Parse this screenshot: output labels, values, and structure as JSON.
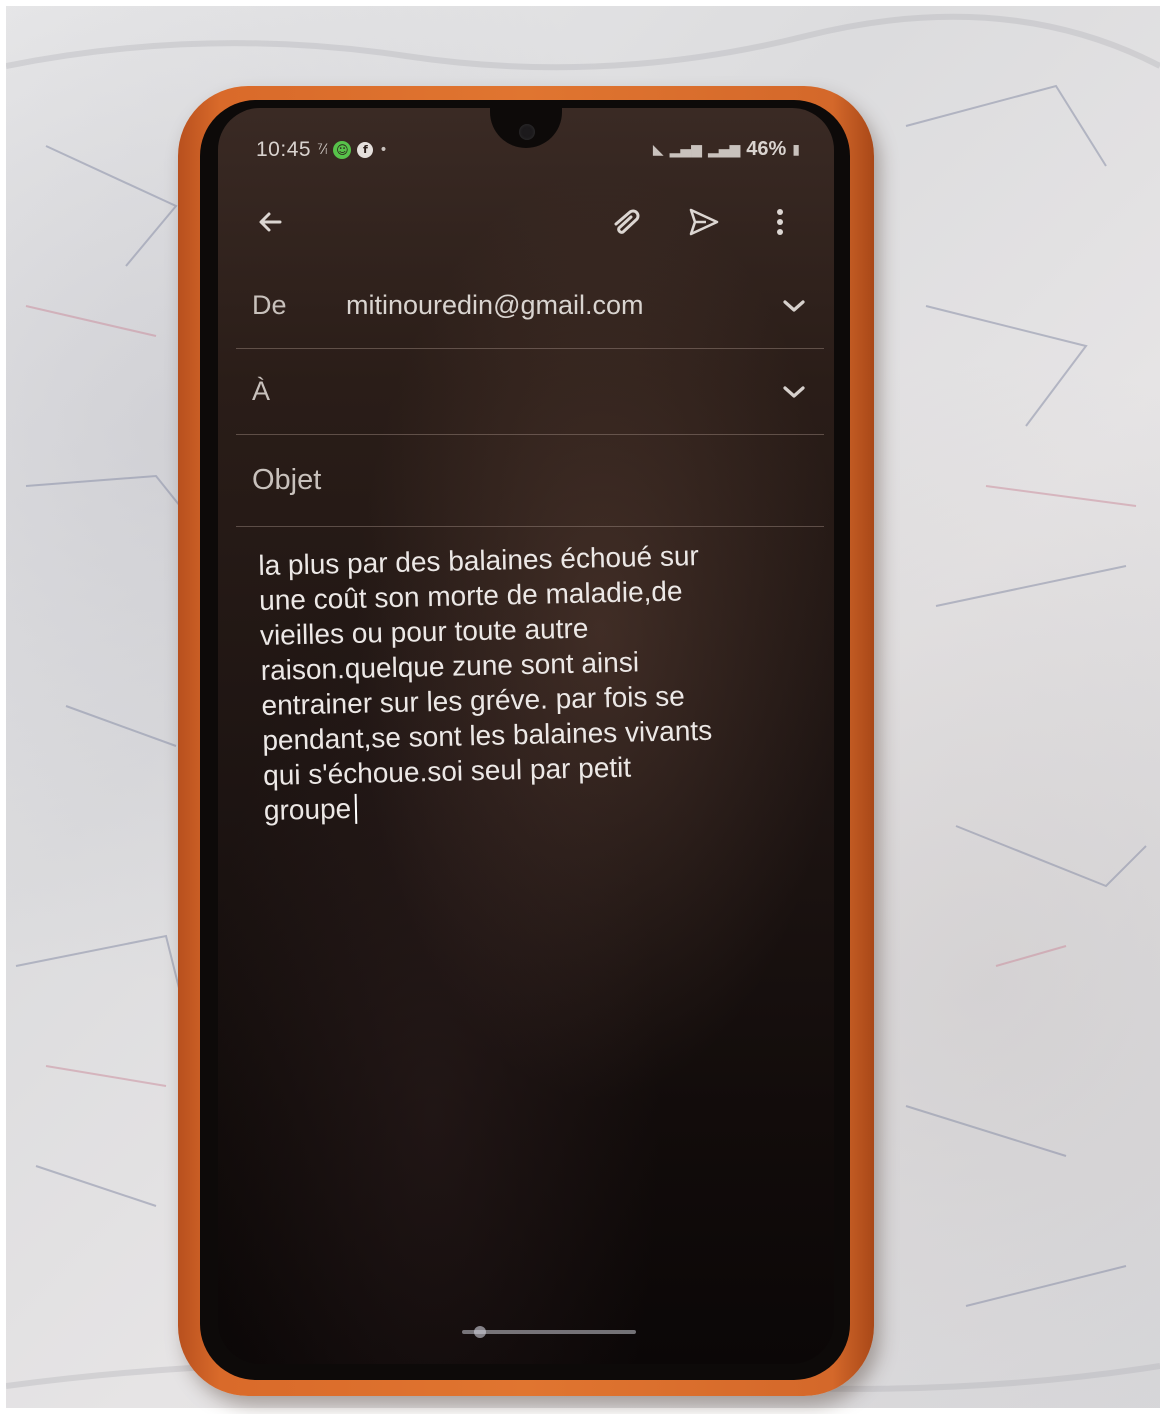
{
  "status_bar": {
    "time": "10:45",
    "battery": "46%"
  },
  "toolbar": {
    "icons": [
      "back-arrow-icon",
      "attachment-icon",
      "send-icon",
      "more-vert-icon"
    ]
  },
  "compose": {
    "from_label": "De",
    "from_value": "mitinouredin@gmail.com",
    "to_label": "À",
    "subject_placeholder": "Objet",
    "body": "la plus par des balaines échoué sur\nune coût son morte de maladie,de\nvieilles ou pour toute autre\nraison.quelque zune sont ainsi\nentrainer sur les gréve. par fois se\npendant,se sont les balaines vivants\nqui s'échoue.soi seul par petit\ngroupe"
  },
  "colors": {
    "case": "#e07530",
    "screen": "#2a1d18",
    "text": "#ece8e6"
  }
}
